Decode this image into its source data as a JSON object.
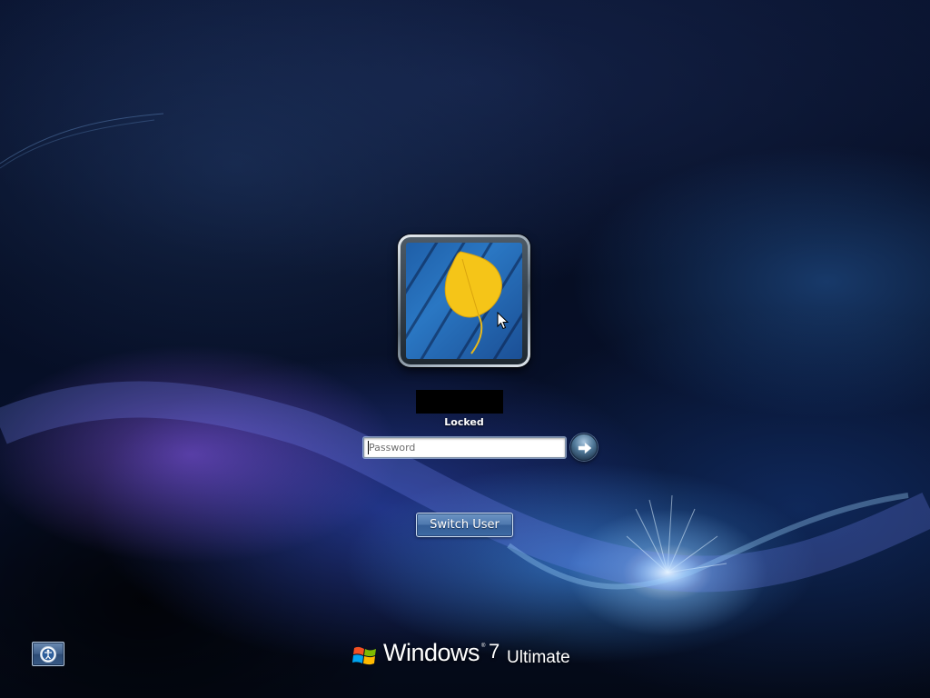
{
  "user": {
    "status": "Locked"
  },
  "login": {
    "password_placeholder": "Password",
    "submit_icon": "arrow-right-icon"
  },
  "actions": {
    "switch_user_label": "Switch User"
  },
  "accessibility": {
    "icon": "ease-of-access-icon"
  },
  "branding": {
    "product": "Windows",
    "version": "7",
    "edition": "Ultimate",
    "trademark": "®"
  },
  "colors": {
    "background": "#050b1c",
    "button_blue": "#4e78ae",
    "status_text": "#ffffff"
  }
}
